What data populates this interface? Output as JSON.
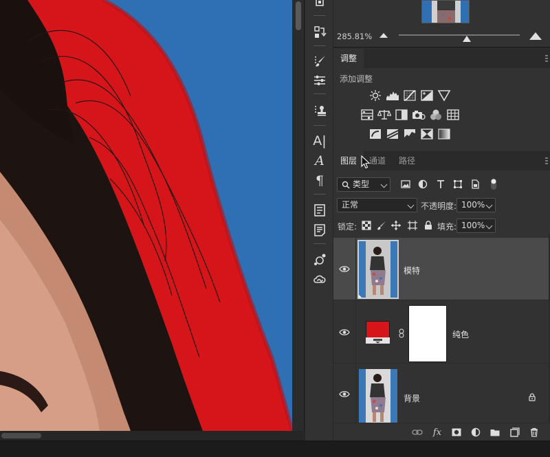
{
  "navigator": {
    "zoom_readout": "285.81%",
    "zoom_level_fraction": 0.56
  },
  "adjustments": {
    "tab_label": "调整",
    "title": "添加调整",
    "row1_icons": [
      "brightness-contrast-icon",
      "levels-icon",
      "curves-icon",
      "exposure-icon",
      "vibrance-icon"
    ],
    "row2_icons": [
      "hue-saturation-icon",
      "color-balance-icon",
      "black-white-icon",
      "photo-filter-icon",
      "channel-mixer-icon",
      "color-lookup-icon"
    ],
    "row3_icons": [
      "invert-icon",
      "posterize-icon",
      "threshold-icon",
      "selective-color-icon",
      "gradient-map-icon"
    ]
  },
  "layers_panel": {
    "tabs": [
      "图层",
      "通道",
      "路径"
    ],
    "active_tab": 0,
    "filter_kind_label": "类型",
    "blend_mode": "正常",
    "opacity_label": "不透明度:",
    "opacity_value": "100%",
    "lock_label": "锁定:",
    "fill_label": "填充:",
    "fill_value": "100%",
    "layers": [
      {
        "name": "模特",
        "visible": true,
        "selected": true,
        "type": "smart-object"
      },
      {
        "name": "纯色",
        "visible": true,
        "selected": false,
        "type": "solid-color",
        "color": "#d5151a"
      },
      {
        "name": "背景",
        "visible": true,
        "selected": false,
        "type": "background",
        "locked": true
      }
    ]
  },
  "colors": {
    "canvas_red": "#d5151a",
    "canvas_blue": "#2f6fb3",
    "panel_bg": "#323232",
    "selected_row": "#4a4a4a"
  }
}
